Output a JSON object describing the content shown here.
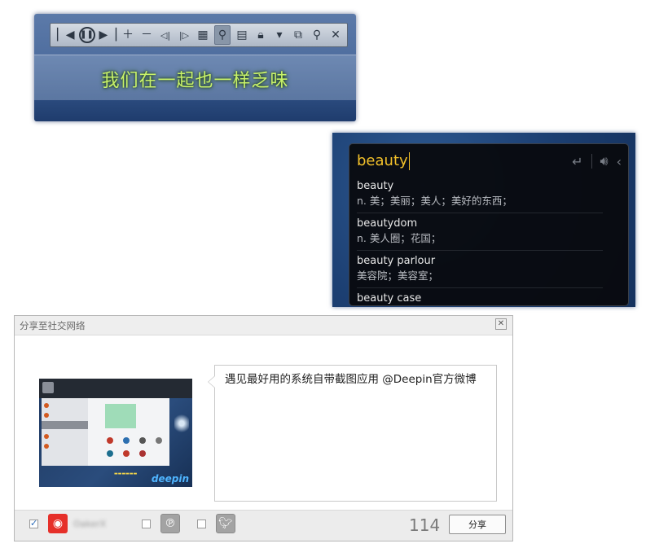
{
  "lyrics_panel": {
    "toolbar_icons": [
      "previous-icon",
      "pause-icon",
      "next-icon",
      "plus-icon",
      "minus-icon",
      "back-icon",
      "forward-icon",
      "grid-icon",
      "lock-position-icon",
      "layout-icon",
      "lock-icon",
      "dropdown-icon",
      "window-icon",
      "search-icon",
      "close-icon"
    ],
    "lyrics_line": "我们在一起也一样乏味"
  },
  "dictionary": {
    "query": "beauty",
    "results": [
      {
        "word": "beauty",
        "definition": "n. 美；美丽；美人；美好的东西；"
      },
      {
        "word": "beautydom",
        "definition": "n. 美人圈；花国；"
      },
      {
        "word": "beauty parlour",
        "definition": "美容院；美容室；"
      },
      {
        "word": "beauty case",
        "definition": ""
      }
    ]
  },
  "share_dialog": {
    "title": "分享至社交网络",
    "message": "遇见最好用的系统自带截图应用 @Deepin官方微博",
    "account_name": "OakerX",
    "char_count": "114",
    "share_button": "分享",
    "thumbnail_logo": "deepin"
  }
}
